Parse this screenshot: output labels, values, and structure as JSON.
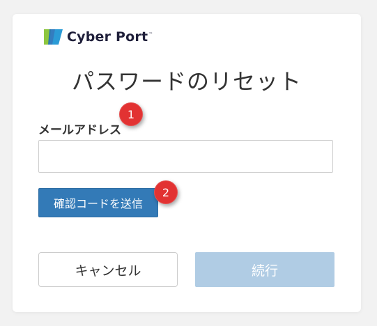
{
  "brand": {
    "name": "Cyber Port",
    "trademark": "™"
  },
  "page": {
    "title": "パスワードのリセット"
  },
  "form": {
    "email_label": "メールアドレス",
    "email_value": "",
    "send_code_label": "確認コードを送信",
    "cancel_label": "キャンセル",
    "continue_label": "続行"
  },
  "annotations": {
    "marker_1": "1",
    "marker_2": "2"
  },
  "colors": {
    "primary": "#337ab7",
    "primary_disabled": "#b0cce4",
    "marker": "#e23232",
    "background": "#f2f2f2",
    "logo_green": "#8dc63f",
    "logo_blue": "#1e6fb8",
    "logo_navy": "#1f1f3a"
  }
}
